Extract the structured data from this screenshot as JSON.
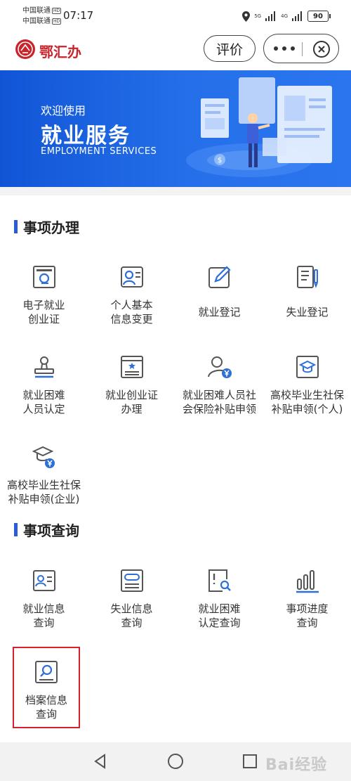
{
  "status_bar": {
    "carrier1": "中国联通",
    "carrier2": "中国联通",
    "hd": "HD",
    "time": "07:17",
    "net1": "5G",
    "net2": "4G",
    "battery": "90"
  },
  "header": {
    "app_name": "鄂汇办",
    "rate_label": "评价"
  },
  "banner": {
    "welcome": "欢迎使用",
    "title": "就业服务",
    "subtitle": "EMPLOYMENT SERVICES"
  },
  "section_handle": {
    "title": "事项办理",
    "items": [
      {
        "line1": "电子就业",
        "line2": "创业证",
        "icon": "e-certificate-icon"
      },
      {
        "line1": "个人基本",
        "line2": "信息变更",
        "icon": "user-info-icon"
      },
      {
        "line1": "就业登记",
        "line2": "",
        "icon": "edit-icon"
      },
      {
        "line1": "失业登记",
        "line2": "",
        "icon": "form-pen-icon"
      },
      {
        "line1": "就业困难",
        "line2": "人员认定",
        "icon": "stamp-icon"
      },
      {
        "line1": "就业创业证",
        "line2": "办理",
        "icon": "certificate-card-icon"
      },
      {
        "line1": "就业困难人员社",
        "line2": "会保险补贴申领",
        "icon": "user-yuan-icon"
      },
      {
        "line1": "高校毕业生社保",
        "line2": "补贴申领(个人)",
        "icon": "graduate-card-icon"
      },
      {
        "line1": "高校毕业生社保",
        "line2": "补贴申领(企业)",
        "icon": "graduate-yuan-icon"
      }
    ]
  },
  "section_query": {
    "title": "事项查询",
    "items": [
      {
        "line1": "就业信息",
        "line2": "查询",
        "icon": "id-card-icon"
      },
      {
        "line1": "失业信息",
        "line2": "查询",
        "icon": "info-card-icon"
      },
      {
        "line1": "就业困难",
        "line2": "认定查询",
        "icon": "doc-search-icon"
      },
      {
        "line1": "事项进度",
        "line2": "查询",
        "icon": "bar-chart-icon"
      },
      {
        "line1": "档案信息",
        "line2": "查询",
        "icon": "search-box-icon"
      }
    ]
  },
  "watermark": "Bai经验",
  "colors": {
    "brand_red": "#c8242b",
    "accent_blue": "#2b5cd6",
    "icon_blue": "#2f6fd8",
    "highlight_red": "#d6202c"
  }
}
